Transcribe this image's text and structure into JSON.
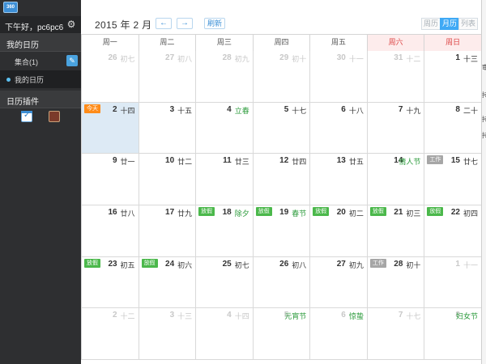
{
  "app": {
    "logo_text": "360"
  },
  "sidebar": {
    "greeting": "下午好，pc6pc6",
    "my_calendar_header": "我的日历",
    "collection_label": "集合(1)",
    "my_calendar_item": "我的日历",
    "plugins_header": "日历插件",
    "plugins": [
      "calendar-check-icon",
      "food-app-icon"
    ]
  },
  "header": {
    "month_title": "2015 年 2 月",
    "prev_label": "←",
    "next_label": "→",
    "refresh_label": "刷新",
    "view_tabs": [
      {
        "label": "周历",
        "active": false
      },
      {
        "label": "月历",
        "active": true
      },
      {
        "label": "列表",
        "active": false
      }
    ]
  },
  "weekdays": [
    "周一",
    "周二",
    "周三",
    "周四",
    "周五",
    "周六",
    "周日"
  ],
  "days": [
    {
      "num": "26",
      "lunar": "初七",
      "other": true
    },
    {
      "num": "27",
      "lunar": "初八",
      "other": true
    },
    {
      "num": "28",
      "lunar": "初九",
      "other": true
    },
    {
      "num": "29",
      "lunar": "初十",
      "other": true
    },
    {
      "num": "30",
      "lunar": "十一",
      "other": true
    },
    {
      "num": "31",
      "lunar": "十二",
      "other": true
    },
    {
      "num": "1",
      "lunar": "十三"
    },
    {
      "num": "2",
      "lunar": "十四",
      "badge": "今天",
      "badge_type": "today-b",
      "today": true
    },
    {
      "num": "3",
      "lunar": "十五"
    },
    {
      "num": "4",
      "lunar": "立春",
      "fest": true
    },
    {
      "num": "5",
      "lunar": "十七"
    },
    {
      "num": "6",
      "lunar": "十八"
    },
    {
      "num": "7",
      "lunar": "十九"
    },
    {
      "num": "8",
      "lunar": "二十"
    },
    {
      "num": "9",
      "lunar": "廿一"
    },
    {
      "num": "10",
      "lunar": "廿二"
    },
    {
      "num": "11",
      "lunar": "廿三"
    },
    {
      "num": "12",
      "lunar": "廿四"
    },
    {
      "num": "13",
      "lunar": "廿五"
    },
    {
      "num": "14",
      "lunar": "情人节",
      "fest": true
    },
    {
      "num": "15",
      "lunar": "廿七",
      "badge": "工作",
      "badge_type": "work"
    },
    {
      "num": "16",
      "lunar": "廿八"
    },
    {
      "num": "17",
      "lunar": "廿九"
    },
    {
      "num": "18",
      "lunar": "除夕",
      "fest": true,
      "badge": "放假",
      "badge_type": "rest"
    },
    {
      "num": "19",
      "lunar": "春节",
      "fest": true,
      "badge": "放假",
      "badge_type": "rest"
    },
    {
      "num": "20",
      "lunar": "初二",
      "badge": "放假",
      "badge_type": "rest"
    },
    {
      "num": "21",
      "lunar": "初三",
      "badge": "放假",
      "badge_type": "rest"
    },
    {
      "num": "22",
      "lunar": "初四",
      "badge": "放假",
      "badge_type": "rest"
    },
    {
      "num": "23",
      "lunar": "初五",
      "badge": "放假",
      "badge_type": "rest"
    },
    {
      "num": "24",
      "lunar": "初六",
      "badge": "放假",
      "badge_type": "rest"
    },
    {
      "num": "25",
      "lunar": "初七"
    },
    {
      "num": "26",
      "lunar": "初八"
    },
    {
      "num": "27",
      "lunar": "初九"
    },
    {
      "num": "28",
      "lunar": "初十",
      "badge": "工作",
      "badge_type": "work"
    },
    {
      "num": "1",
      "lunar": "十一",
      "other": true
    },
    {
      "num": "2",
      "lunar": "十二",
      "other": true
    },
    {
      "num": "3",
      "lunar": "十三",
      "other": true
    },
    {
      "num": "4",
      "lunar": "十四",
      "other": true
    },
    {
      "num": "5",
      "lunar": "元宵节",
      "other": true,
      "fest": true
    },
    {
      "num": "6",
      "lunar": "惊蛰",
      "other": true,
      "fest": true
    },
    {
      "num": "7",
      "lunar": "十七",
      "other": true
    },
    {
      "num": "8",
      "lunar": "妇女节",
      "other": true,
      "fest": true
    }
  ],
  "right_edge_glyphs": [
    "审",
    "持",
    "持",
    "持"
  ]
}
